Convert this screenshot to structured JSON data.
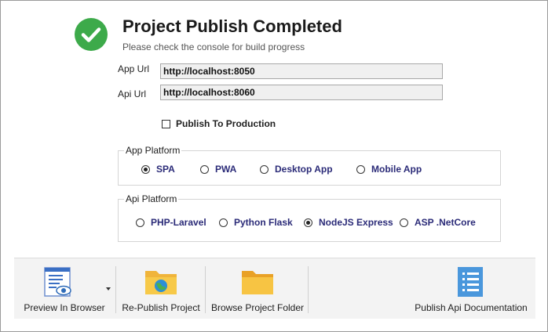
{
  "header": {
    "title": "Project Publish Completed",
    "subtitle": "Please check the console for build progress",
    "status_icon": "check-circle-icon",
    "status_color": "#3daa4a"
  },
  "fields": {
    "app_url_label": "App Url",
    "app_url_value": "http://localhost:8050",
    "api_url_label": "Api Url",
    "api_url_value": "http://localhost:8060"
  },
  "publish_to_production": {
    "label": "Publish To Production",
    "checked": false
  },
  "app_platform": {
    "legend": "App Platform",
    "options": [
      {
        "label": "SPA",
        "selected": true
      },
      {
        "label": "PWA",
        "selected": false
      },
      {
        "label": "Desktop App",
        "selected": false
      },
      {
        "label": "Mobile App",
        "selected": false
      }
    ]
  },
  "api_platform": {
    "legend": "Api Platform",
    "options": [
      {
        "label": "PHP-Laravel",
        "selected": false
      },
      {
        "label": "Python Flask",
        "selected": false
      },
      {
        "label": "NodeJS Express",
        "selected": true
      },
      {
        "label": "ASP .NetCore",
        "selected": false
      }
    ]
  },
  "toolbar": {
    "preview": {
      "label": "Preview In Browser",
      "icon": "browser-preview-icon"
    },
    "republish": {
      "label": "Re-Publish Project",
      "icon": "folder-globe-icon"
    },
    "browse": {
      "label": "Browse Project Folder",
      "icon": "folder-icon"
    },
    "api_docs": {
      "label": "Publish Api Documentation",
      "icon": "list-document-icon"
    }
  }
}
